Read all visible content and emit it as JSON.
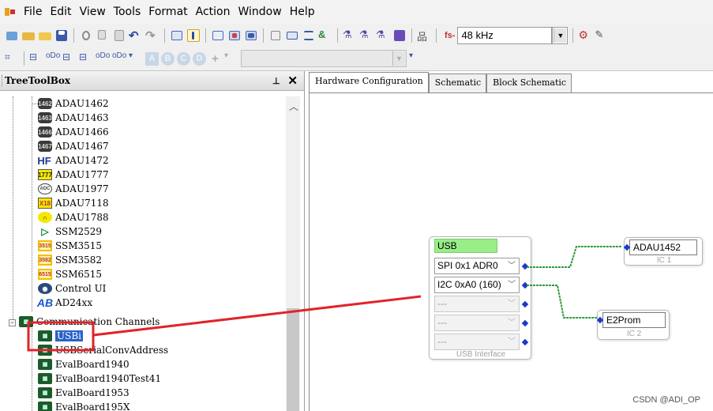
{
  "menubar": {
    "items": [
      "File",
      "Edit",
      "View",
      "Tools",
      "Format",
      "Action",
      "Window",
      "Help"
    ]
  },
  "toolbar": {
    "fs_label": "fs-",
    "sample_rate": "48 kHz",
    "letter_buttons": [
      "A",
      "B",
      "C",
      "D",
      "+"
    ]
  },
  "left_panel": {
    "title": "TreeToolBox",
    "tree": [
      {
        "label": "ADAU1462",
        "icon": "chip-icon"
      },
      {
        "label": "ADAU1463",
        "icon": "chip-icon"
      },
      {
        "label": "ADAU1466",
        "icon": "chip-icon"
      },
      {
        "label": "ADAU1467",
        "icon": "chip-icon"
      },
      {
        "label": "ADAU1472",
        "icon": "hf-icon"
      },
      {
        "label": "ADAU1777",
        "icon": "yellow-chip-icon"
      },
      {
        "label": "ADAU1977",
        "icon": "adc-icon"
      },
      {
        "label": "ADAU7118",
        "icon": "yellow-chip-icon"
      },
      {
        "label": "ADAU1788",
        "icon": "headphone-icon"
      },
      {
        "label": "SSM2529",
        "icon": "amplifier-icon"
      },
      {
        "label": "SSM3515",
        "icon": "ssm-icon"
      },
      {
        "label": "SSM3582",
        "icon": "ssm-icon"
      },
      {
        "label": "SSM6515",
        "icon": "ssm-icon"
      },
      {
        "label": "Control UI",
        "icon": "control-icon"
      },
      {
        "label": "AD24xx",
        "icon": "ad24-icon"
      },
      {
        "label": "Communication Channels",
        "icon": "board-icon"
      },
      {
        "label": "USBi",
        "icon": "board-icon"
      },
      {
        "label": "USBSerialConvAddress",
        "icon": "board-icon"
      },
      {
        "label": "EvalBoard1940",
        "icon": "board-icon"
      },
      {
        "label": "EvalBoard1940Test41",
        "icon": "board-icon"
      },
      {
        "label": "EvalBoard1953",
        "icon": "board-icon"
      },
      {
        "label": "EvalBoard195X",
        "icon": "board-icon"
      }
    ]
  },
  "tabs": [
    "Hardware Configuration",
    "Schematic",
    "Block Schematic"
  ],
  "diagram": {
    "usb_block": {
      "title": "USB",
      "selects": [
        {
          "value": "SPI 0x1 ADR0",
          "enabled": true
        },
        {
          "value": "I2C 0xA0 (160)",
          "enabled": true
        },
        {
          "value": "---",
          "enabled": false
        },
        {
          "value": "---",
          "enabled": false
        },
        {
          "value": "---",
          "enabled": false
        }
      ],
      "caption": "USB Interface"
    },
    "ic1": {
      "name": "ADAU1452",
      "caption": "IC 1"
    },
    "ic2": {
      "name": "E2Prom",
      "caption": "IC 2"
    },
    "wire_color": "#2e9a3a",
    "port_color": "#1a3acb",
    "highlight_color": "#e0242a"
  },
  "watermark": "CSDN @ADI_OP"
}
